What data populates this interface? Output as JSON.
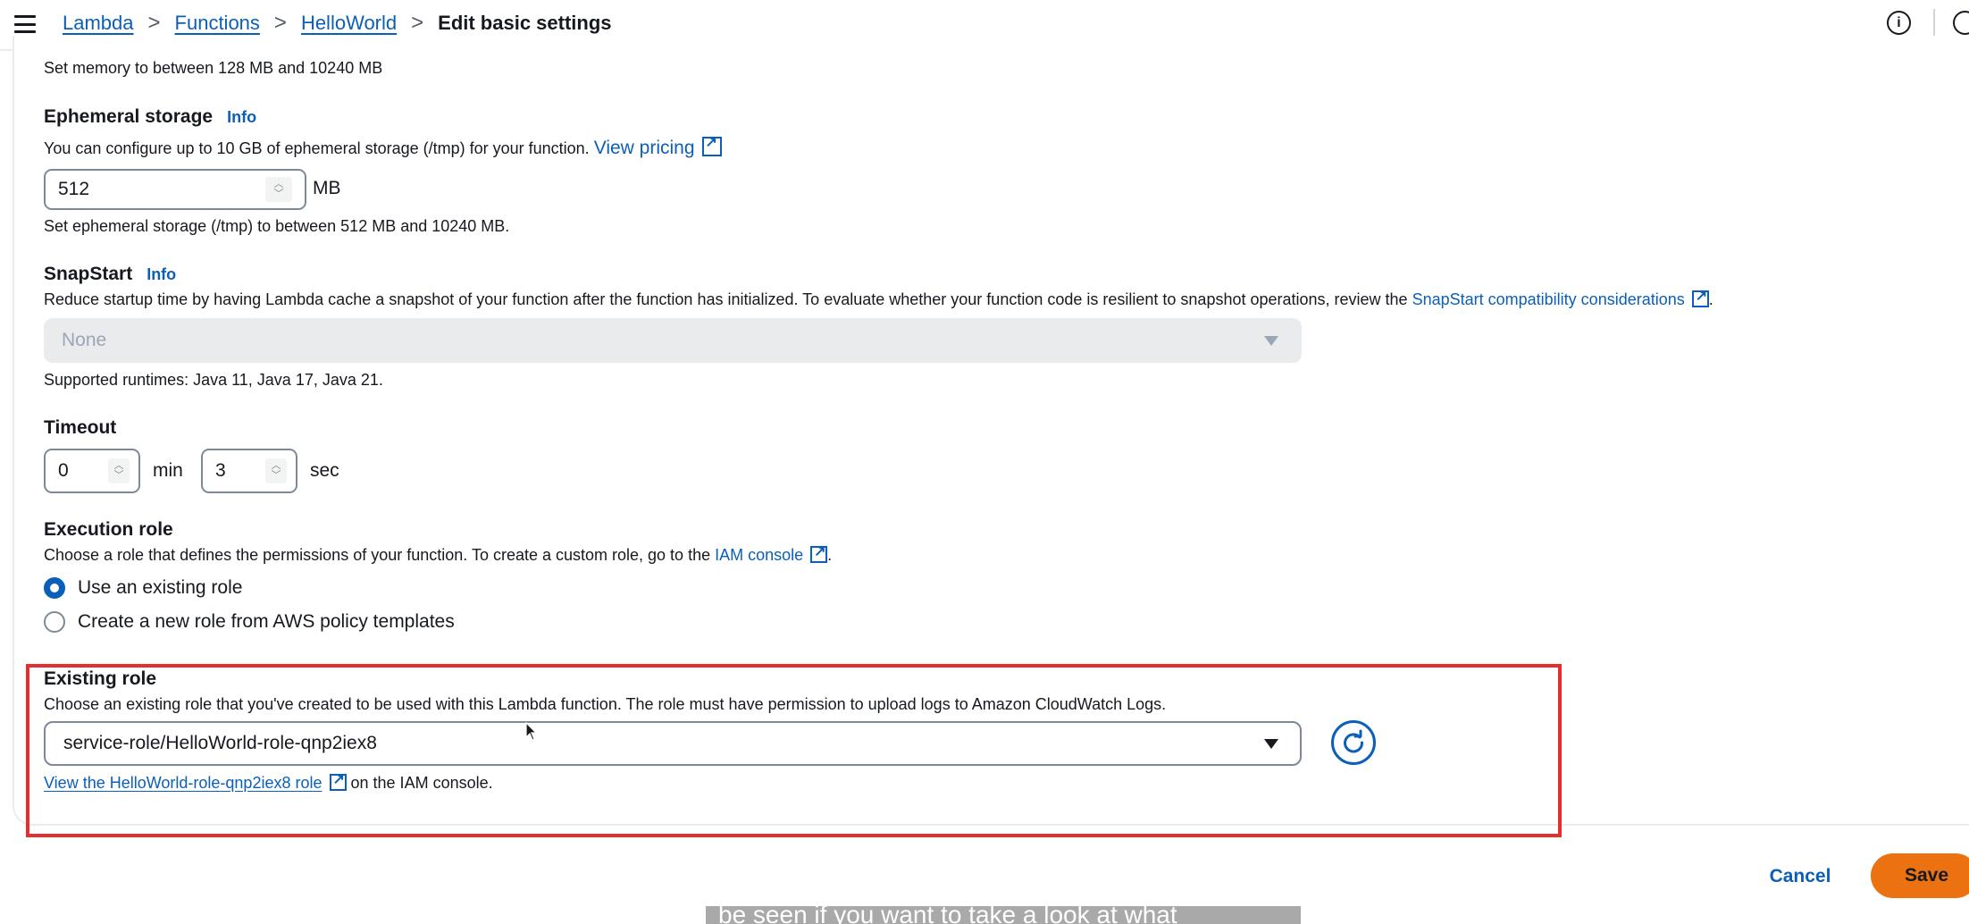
{
  "breadcrumb": {
    "items": [
      "Lambda",
      "Functions",
      "HelloWorld"
    ],
    "current": "Edit basic settings",
    "separator": ">"
  },
  "memory": {
    "help": "Set memory to between 128 MB and 10240 MB"
  },
  "ephemeral_storage": {
    "label": "Ephemeral storage",
    "info": "Info",
    "description": "You can configure up to 10 GB of ephemeral storage (/tmp) for your function.",
    "pricing_link": "View pricing",
    "value": "512",
    "unit": "MB",
    "help": "Set ephemeral storage (/tmp) to between 512 MB and 10240 MB."
  },
  "snapstart": {
    "label": "SnapStart",
    "info": "Info",
    "description": "Reduce startup time by having Lambda cache a snapshot of your function after the function has initialized. To evaluate whether your function code is resilient to snapshot operations, review the",
    "link": "SnapStart compatibility considerations",
    "period": ".",
    "value": "None",
    "help": "Supported runtimes: Java 11, Java 17, Java 21."
  },
  "timeout": {
    "label": "Timeout",
    "min_value": "0",
    "min_unit": "min",
    "sec_value": "3",
    "sec_unit": "sec"
  },
  "execution_role": {
    "label": "Execution role",
    "description": "Choose a role that defines the permissions of your function. To create a custom role, go to the",
    "iam_link": "IAM console",
    "period": ".",
    "options": [
      "Use an existing role",
      "Create a new role from AWS policy templates"
    ],
    "selected": "Use an existing role"
  },
  "existing_role": {
    "label": "Existing role",
    "description": "Choose an existing role that you've created to be used with this Lambda function. The role must have permission to upload logs to Amazon CloudWatch Logs.",
    "value": "service-role/HelloWorld-role-qnp2iex8",
    "view_link": "View the HelloWorld-role-qnp2iex8 role",
    "view_suffix": "on the IAM console."
  },
  "actions": {
    "cancel": "Cancel",
    "save": "Save"
  },
  "caption": "be seen if you want to take a look at what",
  "colors": {
    "link": "#0b5fb8",
    "primary_button": "#ec7211",
    "highlight": "#e3302f"
  },
  "icons": [
    "menu-icon",
    "chevron-right-icon",
    "info-circle-icon",
    "external-link-icon",
    "caret-down-icon",
    "refresh-icon",
    "mouse-cursor-icon"
  ]
}
